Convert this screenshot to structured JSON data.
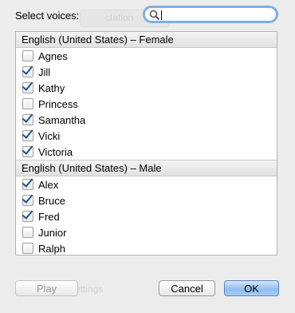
{
  "dialog": {
    "prompt": "Select voices:",
    "search": {
      "value": "",
      "placeholder": ""
    }
  },
  "groups": [
    {
      "title": "English (United States) – Female",
      "voices": [
        {
          "name": "Agnes",
          "checked": false
        },
        {
          "name": "Jill",
          "checked": true
        },
        {
          "name": "Kathy",
          "checked": true
        },
        {
          "name": "Princess",
          "checked": false
        },
        {
          "name": "Samantha",
          "checked": true
        },
        {
          "name": "Vicki",
          "checked": true
        },
        {
          "name": "Victoria",
          "checked": true
        }
      ]
    },
    {
      "title": "English (United States) – Male",
      "voices": [
        {
          "name": "Alex",
          "checked": true
        },
        {
          "name": "Bruce",
          "checked": true
        },
        {
          "name": "Fred",
          "checked": true
        },
        {
          "name": "Junior",
          "checked": false
        },
        {
          "name": "Ralph",
          "checked": false
        }
      ]
    }
  ],
  "buttons": {
    "play": "Play",
    "cancel": "Cancel",
    "ok": "OK"
  },
  "background": {
    "ghost_tab": "ctation",
    "ghost_settings": "ettings"
  },
  "colors": {
    "check": "#1b4f9c",
    "search_focus": "#7eaee6",
    "ok_button": "#8fbdf0"
  }
}
